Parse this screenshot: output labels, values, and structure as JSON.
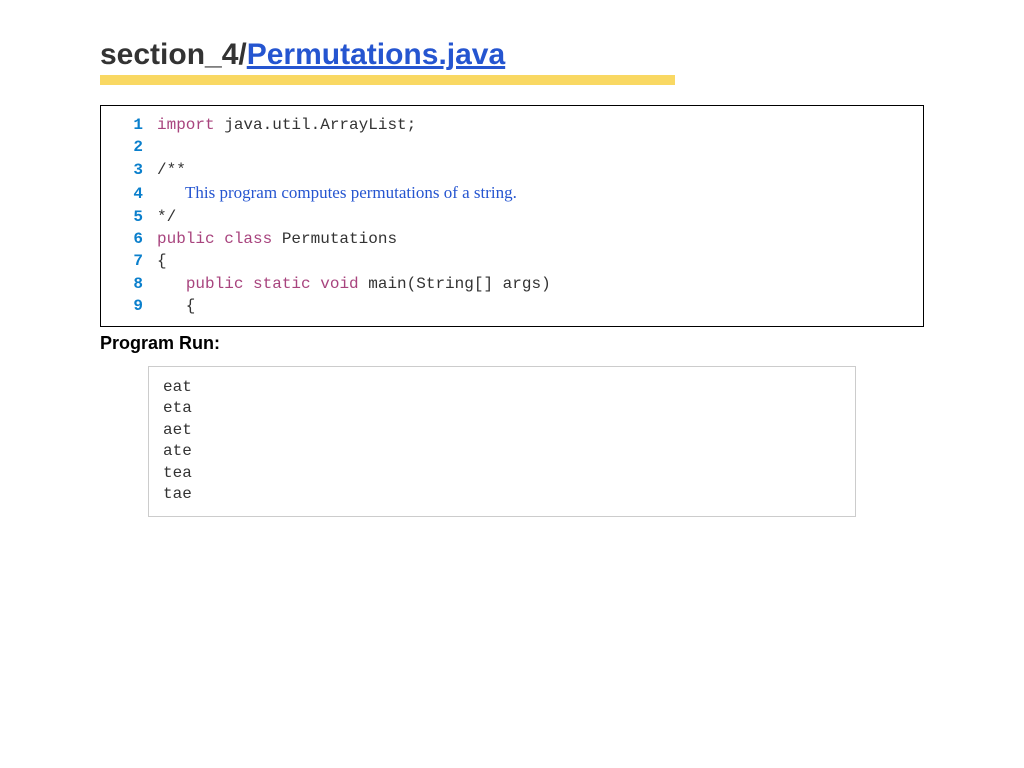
{
  "title": {
    "prefix": "section_4/",
    "link": "Permutations.java"
  },
  "code": {
    "lines": [
      {
        "num": "1",
        "tokens": [
          {
            "cls": "kw-import",
            "t": "import"
          },
          {
            "cls": "code-text",
            "t": " java.util.ArrayList;"
          }
        ]
      },
      {
        "num": "2",
        "tokens": []
      },
      {
        "num": "3",
        "tokens": [
          {
            "cls": "code-text",
            "t": "/**"
          }
        ]
      },
      {
        "num": "4",
        "comment": "This program computes permutations of a string."
      },
      {
        "num": "5",
        "tokens": [
          {
            "cls": "code-text",
            "t": "*/"
          }
        ]
      },
      {
        "num": "6",
        "tokens": [
          {
            "cls": "kw-public",
            "t": "public class"
          },
          {
            "cls": "code-text",
            "t": " Permutations"
          }
        ]
      },
      {
        "num": "7",
        "tokens": [
          {
            "cls": "code-text",
            "t": "{"
          }
        ]
      },
      {
        "num": "8",
        "tokens": [
          {
            "cls": "code-text",
            "t": "   "
          },
          {
            "cls": "kw-public",
            "t": "public static void"
          },
          {
            "cls": "code-text",
            "t": " main(String[] args)"
          }
        ]
      },
      {
        "num": "9",
        "tokens": [
          {
            "cls": "code-text",
            "t": "   {"
          }
        ]
      }
    ]
  },
  "program_run_label": "Program Run:",
  "output": [
    "eat",
    "eta",
    "aet",
    "ate",
    "tea",
    "tae"
  ]
}
